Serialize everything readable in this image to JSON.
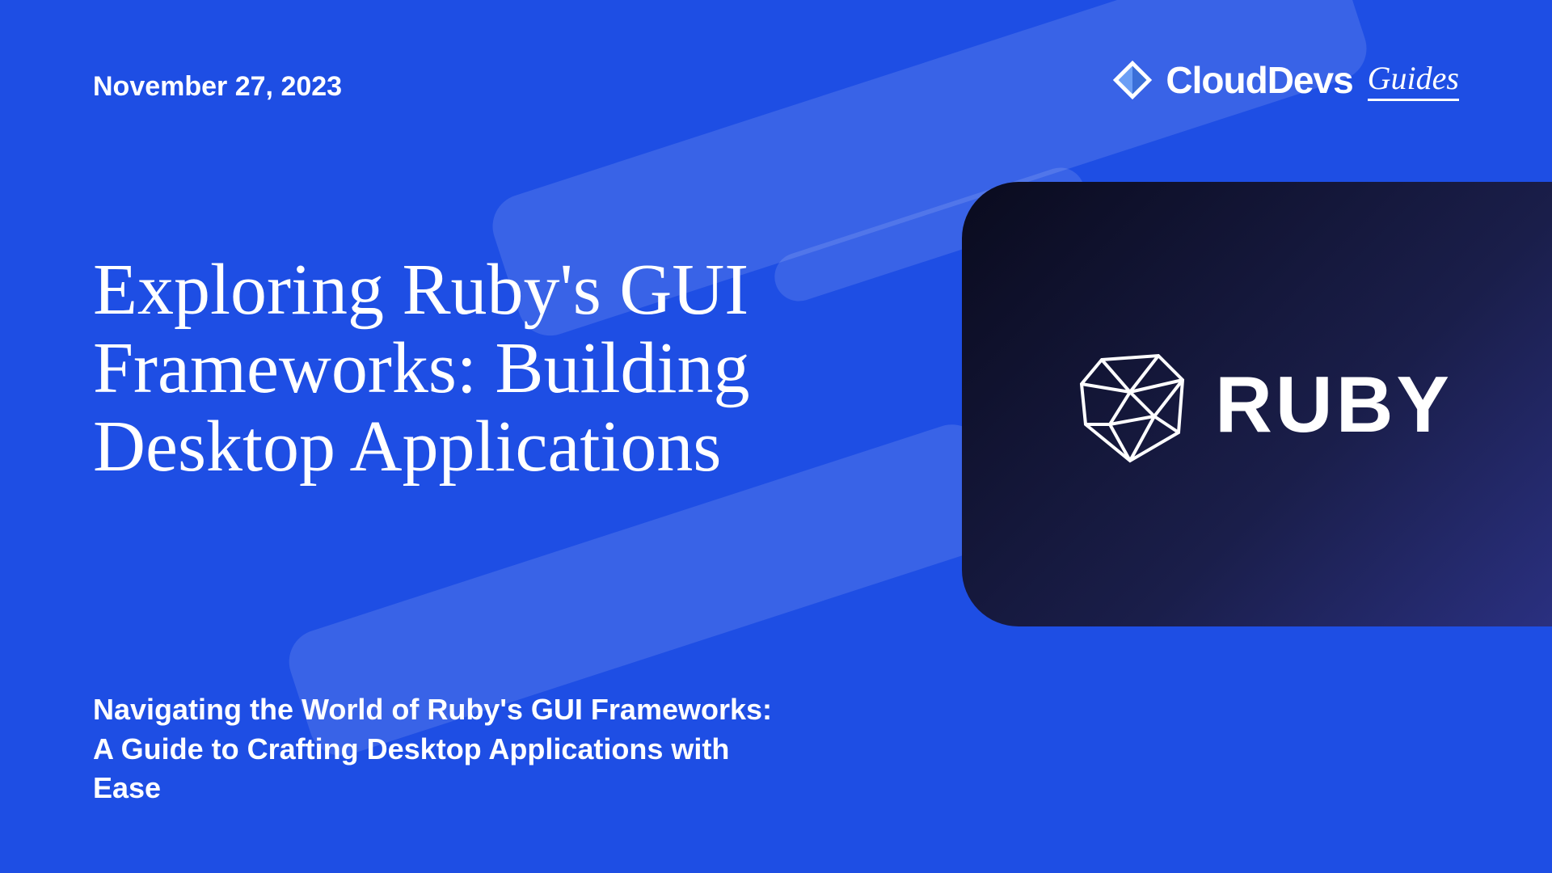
{
  "date": "November 27, 2023",
  "logo": {
    "brand": "CloudDevs",
    "suffix": "Guides"
  },
  "title": "Exploring Ruby's GUI Frameworks: Building Desktop Applications",
  "subtitle": "Navigating the World of Ruby's GUI Frameworks: A Guide to Crafting Desktop Applications with Ease",
  "card": {
    "label": "RUBY"
  }
}
